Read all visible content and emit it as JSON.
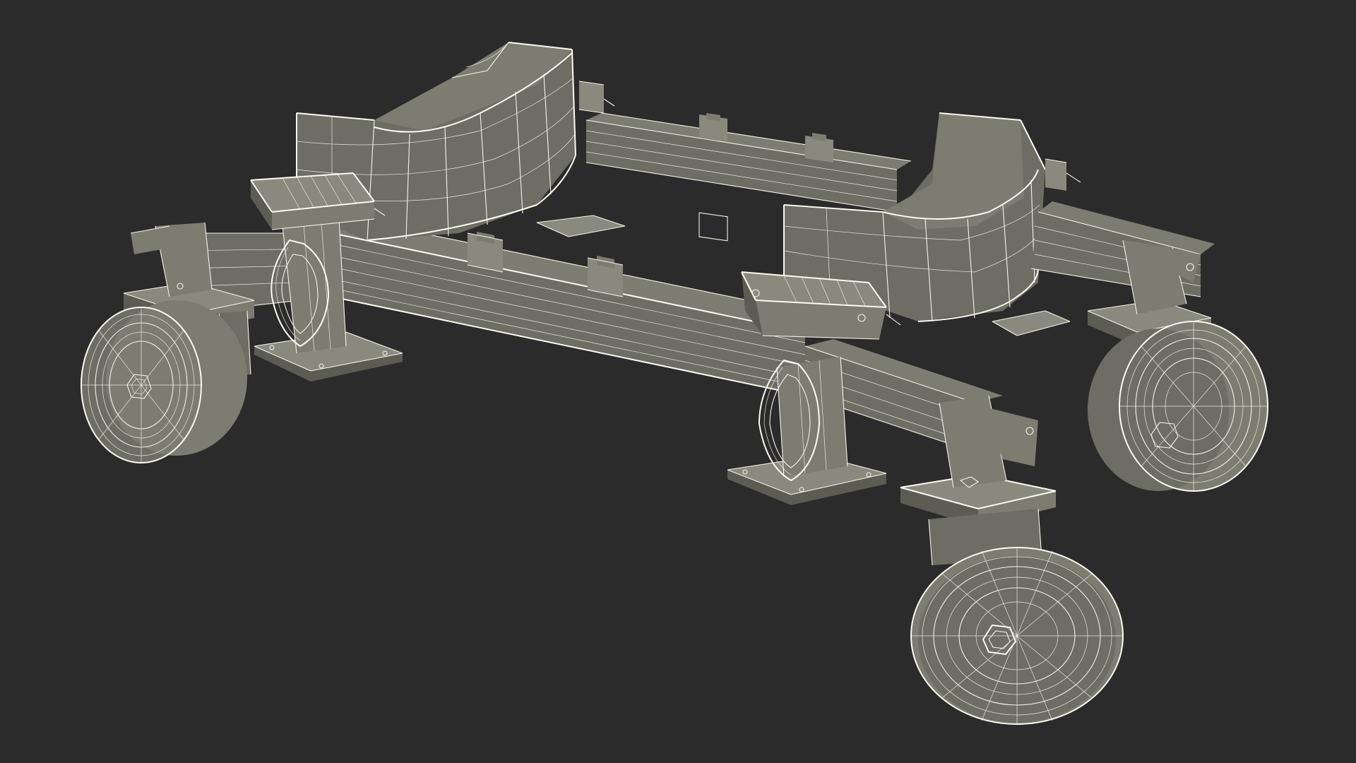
{
  "scene": {
    "background": "#2b2b2b",
    "model": "wireframe-dolly-with-casters",
    "surface_colors": [
      "#6e6d63",
      "#7d7c71",
      "#5d5c53",
      "#8a897e"
    ],
    "wire_color": "#f6f4e8"
  }
}
